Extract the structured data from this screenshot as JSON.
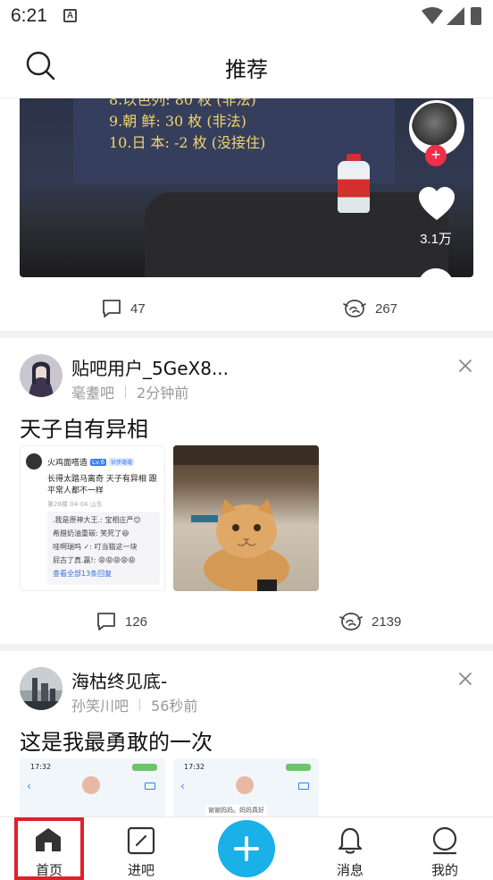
{
  "status_bar": {
    "time": "6:21",
    "a_icon": "A"
  },
  "header": {
    "title": "推荐",
    "search_icon": "search-icon"
  },
  "video_post": {
    "screen_lines": [
      "8.以色列: 80 枚 (非法)",
      "9.朝  鲜: 30 枚  (非法)",
      "10.日  本: -2 枚 (没接住)"
    ],
    "like_count": "3.1万",
    "comments": "47",
    "shares": "267"
  },
  "posts": [
    {
      "username": "贴吧用户_5GeX8...",
      "forum": "毫耋吧",
      "time": "2分钟前",
      "content": "天子自有异相",
      "comments": "126",
      "shares": "2139",
      "thumb1": {
        "user": "火鸡面嗒造",
        "level": "Lv.6",
        "badge": "砂步毫毫",
        "title": "长得太踏马离奇 天子有异相 跟平常人都不一样",
        "floor": "第28楼 04-04 山东",
        "replies": [
          ".我是原神大王.: 宝相庄严😊",
          "希腊奶油重碳: 笑死了😆",
          "哇啊瑞呜 ✓: 叮当猫这一块",
          "屁古了真.赢!: 😩😩😩😩😩"
        ],
        "more": "查看全部13条回复"
      }
    },
    {
      "username": "海枯终见底-",
      "forum": "孙笑川吧",
      "time": "56秒前",
      "content": "这是我最勇敢的一次",
      "thumb_time": "17:32",
      "thumb_text": "谢谢妈妈。妈妈真好"
    }
  ],
  "tabbar": {
    "tabs": [
      {
        "label": "首页",
        "icon": "home-icon"
      },
      {
        "label": "进吧",
        "icon": "enter-forum-icon"
      },
      {
        "label": "",
        "icon": "plus-icon"
      },
      {
        "label": "消息",
        "icon": "bell-icon"
      },
      {
        "label": "我的",
        "icon": "profile-icon"
      }
    ]
  },
  "colors": {
    "accent": "#1ab0e8",
    "highlight": "#e0202a",
    "like_badge": "#f02e4a"
  }
}
